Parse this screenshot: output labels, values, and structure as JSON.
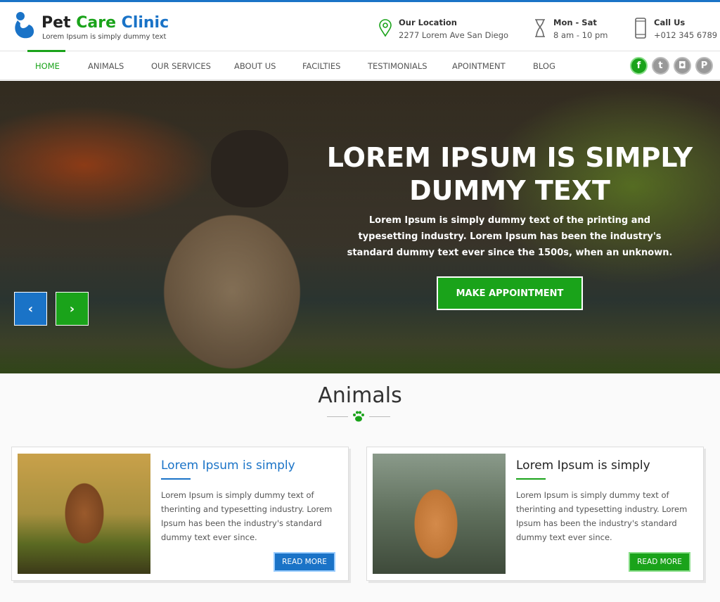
{
  "brand": {
    "name_1": "Pet",
    "name_2": "Care",
    "name_3": "Clinic",
    "tagline": "Lorem Ipsum is simply dummy text"
  },
  "info": [
    {
      "icon": "location-pin-icon",
      "title": "Our Location",
      "text": "2277 Lorem Ave San Diego"
    },
    {
      "icon": "hourglass-icon",
      "title": "Mon - Sat",
      "text": "8 am - 10 pm"
    },
    {
      "icon": "phone-icon",
      "title": "Call Us",
      "text": "+012 345 6789"
    }
  ],
  "nav": [
    "HOME",
    "ANIMALS",
    "OUR SERVICES",
    "ABOUT US",
    "FACILTIES",
    "TESTIMONIALS",
    "APOINTMENT",
    "BLOG"
  ],
  "nav_active": "HOME",
  "social": {
    "facebook": "f",
    "twitter": "t",
    "instagram": "◘",
    "pinterest": "P"
  },
  "hero": {
    "title": "LOREM IPSUM IS SIMPLY DUMMY TEXT",
    "text": "Lorem Ipsum is simply dummy text of the printing and typesetting industry. Lorem Ipsum has been the industry's standard dummy text ever since the 1500s, when an unknown.",
    "cta": "MAKE APPOINTMENT",
    "prev": "‹",
    "next": "›"
  },
  "animals": {
    "title": "Animals",
    "cards": [
      {
        "title": "Lorem Ipsum is simply",
        "text": "Lorem Ipsum is simply dummy text of therinting and typesetting industry. Lorem Ipsum has been the industry's standard dummy text ever since.",
        "button": "READ MORE",
        "accent": "#1a73c7"
      },
      {
        "title": "Lorem Ipsum is simply",
        "text": "Lorem Ipsum is simply dummy text of therinting and typesetting industry. Lorem Ipsum has been the industry's standard dummy text ever since.",
        "button": "READ MORE",
        "accent": "#1aa31a"
      }
    ]
  },
  "colors": {
    "blue": "#1a73c7",
    "green": "#1aa31a"
  }
}
